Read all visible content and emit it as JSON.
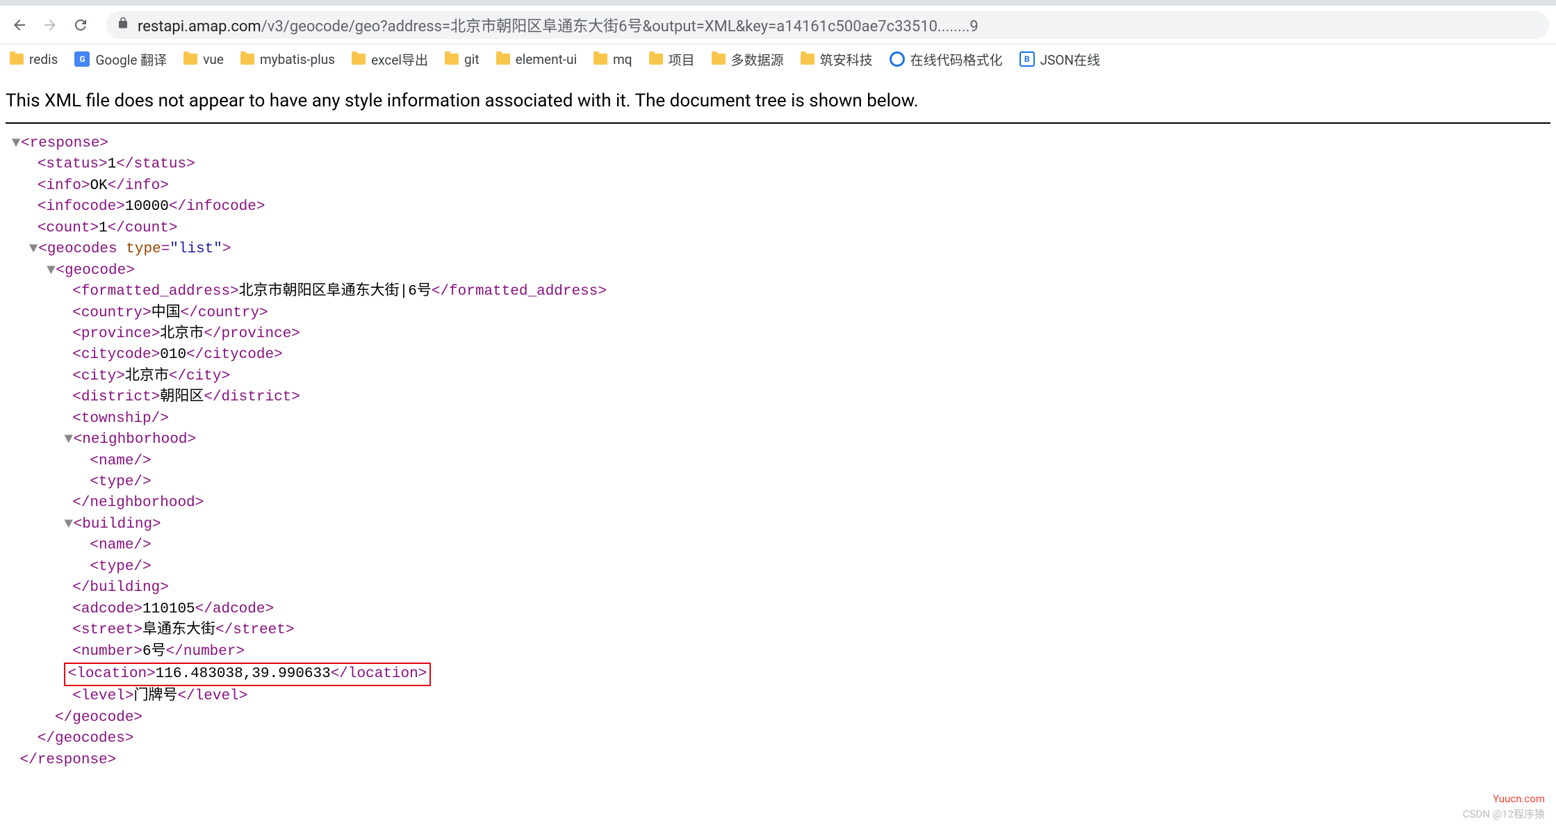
{
  "browser": {
    "url_domain": "restapi.amap.com",
    "url_path": "/v3/geocode/geo?address=北京市朝阳区阜通东大街6号&output=XML&key=a14161c500ae7c33510........9"
  },
  "bookmarks": [
    {
      "type": "folder",
      "label": "redis"
    },
    {
      "type": "translate",
      "label": "Google 翻译"
    },
    {
      "type": "folder",
      "label": "vue"
    },
    {
      "type": "folder",
      "label": "mybatis-plus"
    },
    {
      "type": "folder",
      "label": "excel导出"
    },
    {
      "type": "folder",
      "label": "git"
    },
    {
      "type": "folder",
      "label": "element-ui"
    },
    {
      "type": "folder",
      "label": "mq"
    },
    {
      "type": "folder",
      "label": "项目"
    },
    {
      "type": "folder",
      "label": "多数据源"
    },
    {
      "type": "folder",
      "label": "筑安科技"
    },
    {
      "type": "circle",
      "label": "在线代码格式化"
    },
    {
      "type": "json",
      "label": "JSON在线"
    }
  ],
  "notice": "This XML file does not appear to have any style information associated with it. The document tree is shown below.",
  "xml": {
    "status": "1",
    "info": "OK",
    "infocode": "10000",
    "count": "1",
    "geocodes_attr": "type=\"list\"",
    "formatted_address": "北京市朝阳区阜通东大街|6号",
    "country": "中国",
    "province": "北京市",
    "citycode": "010",
    "city": "北京市",
    "district": "朝阳区",
    "adcode": "110105",
    "street": "阜通东大街",
    "number": "6号",
    "location": "116.483038,39.990633",
    "level": "门牌号"
  },
  "watermark": {
    "line1": "Yuucn.com",
    "line2": "CSDN @12程序猿"
  }
}
